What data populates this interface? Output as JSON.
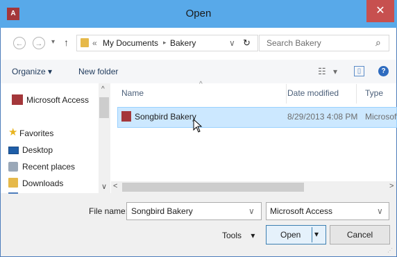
{
  "window": {
    "title": "Open",
    "app_icon_text": "A",
    "close_glyph": "✕"
  },
  "nav": {
    "back_glyph": "←",
    "forward_glyph": "→",
    "history_glyph": "▾",
    "up_glyph": "↑",
    "breadcrumb_prefix": "«",
    "path": [
      "My Documents",
      "Bakery"
    ],
    "separator": "▸",
    "dropdown_glyph": "∨",
    "refresh_glyph": "↻",
    "search_placeholder": "Search Bakery",
    "search_glyph": "⌕"
  },
  "toolbar": {
    "organize": "Organize",
    "organize_arrow": "▾",
    "new_folder": "New folder",
    "view_glyph": "☷",
    "view_arrow": "▾",
    "preview_glyph": "▯",
    "help_glyph": "?"
  },
  "sidebar": {
    "items": [
      {
        "label": "Microsoft Access",
        "icon": "access-icon"
      },
      {
        "label": "Favorites",
        "icon": "star-icon"
      },
      {
        "label": "Desktop",
        "icon": "desktop-icon"
      },
      {
        "label": "Recent places",
        "icon": "recent-places-icon"
      },
      {
        "label": "Downloads",
        "icon": "downloads-icon"
      }
    ],
    "scroll_up": "^",
    "collapse_glyph": "∨"
  },
  "file_list": {
    "columns": [
      "Name",
      "Date modified",
      "Type"
    ],
    "sort_glyph": "^",
    "rows": [
      {
        "name": "Songbird Bakery",
        "date": "8/29/2013 4:08 PM",
        "type": "Microsoft"
      }
    ],
    "scroll_left": "<",
    "scroll_right": ">"
  },
  "footer": {
    "file_name_label": "File name:",
    "file_name_value": "Songbird Bakery",
    "file_name_arrow": "∨",
    "filter_value": "Microsoft Access",
    "filter_arrow": "∨",
    "tools": "Tools",
    "tools_arrow": "▾",
    "open": "Open",
    "open_arrow": "▾",
    "cancel": "Cancel"
  },
  "colors": {
    "titlebar": "#58a9e9",
    "close": "#c7504f",
    "selection": "#cce8ff",
    "access_red": "#a4373a"
  }
}
